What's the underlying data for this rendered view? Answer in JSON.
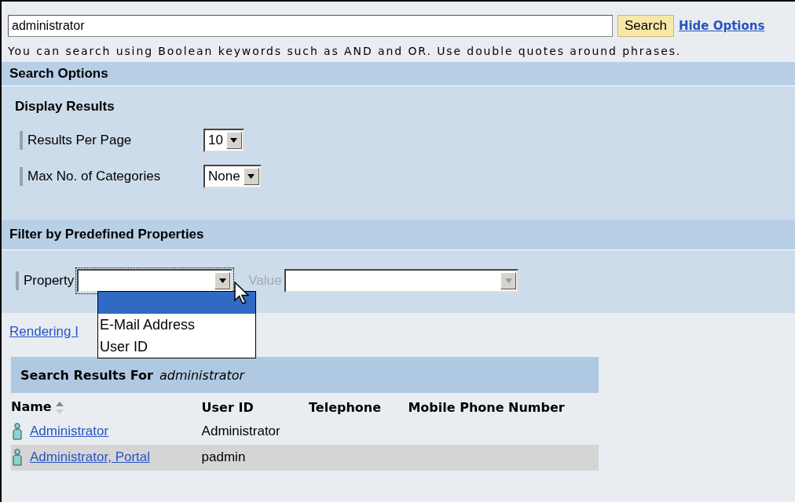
{
  "search": {
    "value": "administrator",
    "button": "Search",
    "link": "Hide Options"
  },
  "hint": "You can search using Boolean keywords such as AND and OR. Use double quotes around phrases.",
  "search_options": {
    "title": "Search Options"
  },
  "display_results": {
    "title": "Display Results",
    "fields": [
      {
        "label": "Results Per Page",
        "value": "10"
      },
      {
        "label": "Max No. of Categories",
        "value": "None"
      }
    ]
  },
  "filter": {
    "title": "Filter by Predefined Properties",
    "fields": [
      {
        "label": "Property",
        "disabled": false,
        "focused": true,
        "expanded": true
      },
      {
        "label": "Value",
        "disabled": true,
        "focused": false
      }
    ]
  },
  "dropdown_options": [
    {
      "selected": true
    },
    {
      "label": "E-Mail Address",
      "selected": false
    },
    {
      "label": "User ID",
      "selected": false
    }
  ],
  "rendering_link": "Rendering I",
  "results": {
    "title": "Search Results For",
    "query": "administrator",
    "columns": [
      {
        "label": "Name",
        "sorted": true
      },
      {
        "label": "User ID",
        "sorted": false
      },
      {
        "label": "Telephone",
        "sorted": false
      },
      {
        "label": "Mobile Phone Number",
        "sorted": false
      }
    ],
    "rows": [
      {
        "name": "Administrator",
        "user_id": "Administrator"
      },
      {
        "name": "Administrator, Portal",
        "user_id": "padmin"
      }
    ]
  }
}
